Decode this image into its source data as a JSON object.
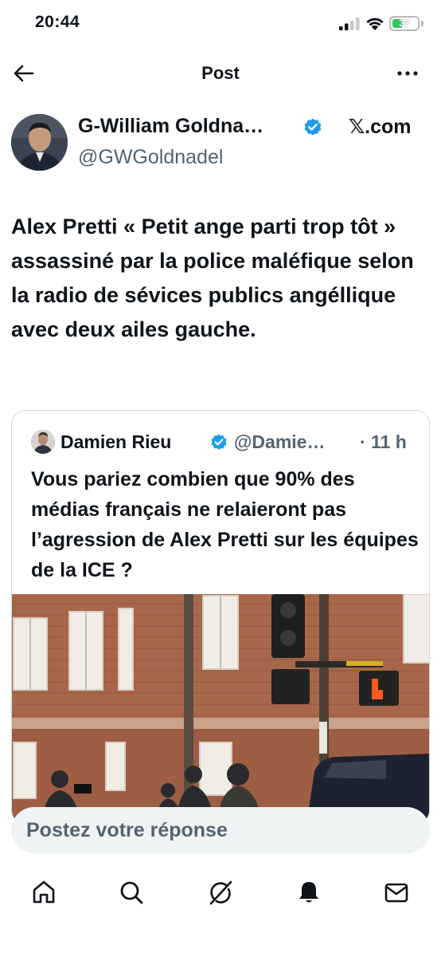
{
  "status_bar": {
    "time": "20:44",
    "battery": "37"
  },
  "header": {
    "title": "Post"
  },
  "post": {
    "author_name": "G-William Goldna…",
    "author_handle": "@GWGoldnadel",
    "source": "𝕏.com",
    "text": "Alex Pretti «  Petit ange parti trop tôt » assassiné par la police maléfique selon la radio de sévices publics angéllique avec deux ailes gauche."
  },
  "quote": {
    "author_name": "Damien Rieu",
    "author_handle": "@Damie…",
    "time": "· 11 h",
    "text": "Vous pariez combien que 90% des médias français ne relaieront pas l’agression de Alex Pretti sur les équipes de la ICE ?"
  },
  "reply": {
    "placeholder": "Postez votre réponse"
  },
  "tabs": [
    {
      "icon": "home-icon"
    },
    {
      "icon": "search-icon"
    },
    {
      "icon": "grok-icon"
    },
    {
      "icon": "bell-icon"
    },
    {
      "icon": "mail-icon"
    }
  ],
  "colors": {
    "verified": "#1d9bf0",
    "text": "#0f1419",
    "secondary": "#536471",
    "reply_bg": "#eff3f4"
  }
}
